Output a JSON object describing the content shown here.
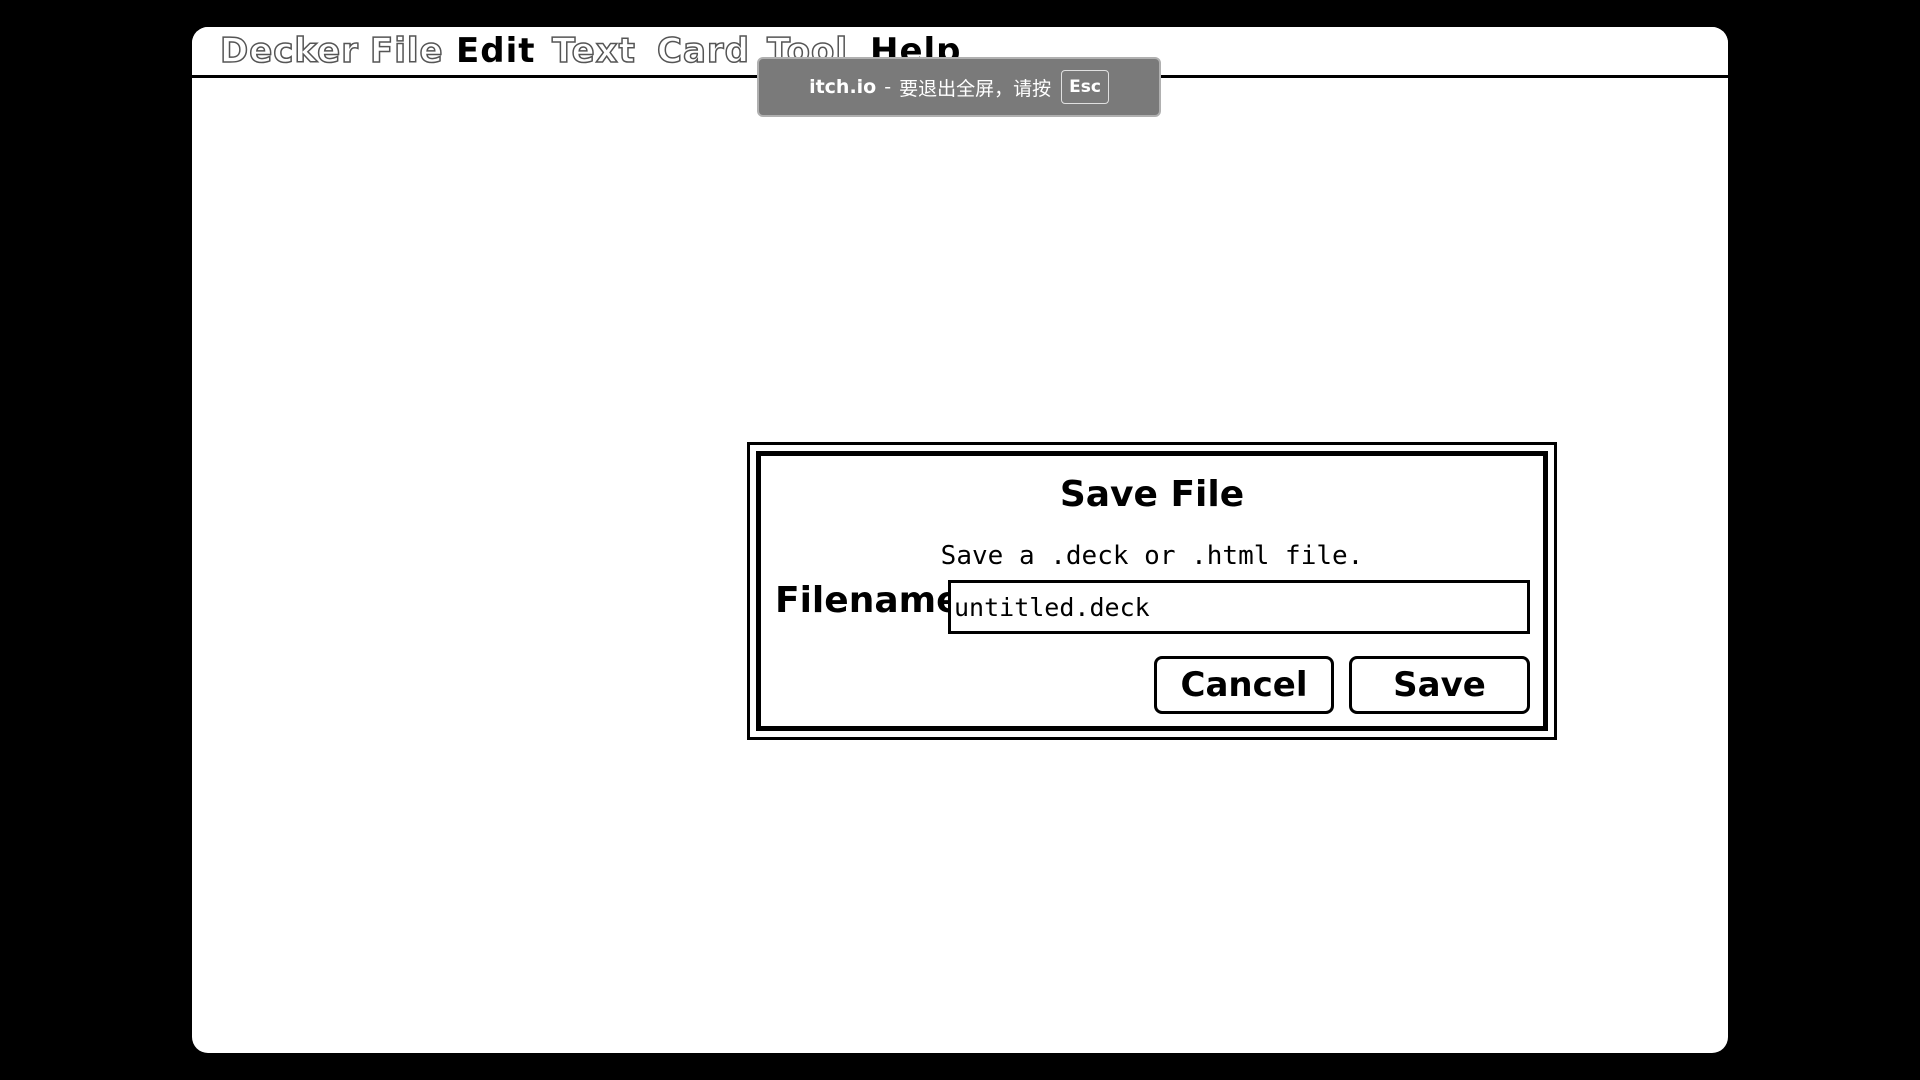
{
  "menubar": {
    "items": [
      {
        "label": "Decker",
        "enabled": false
      },
      {
        "label": "File",
        "enabled": false
      },
      {
        "label": "Edit",
        "enabled": true
      },
      {
        "label": "Text",
        "enabled": false
      },
      {
        "label": "Card",
        "enabled": false
      },
      {
        "label": "Tool",
        "enabled": false
      },
      {
        "label": "Help",
        "enabled": true
      }
    ]
  },
  "toast": {
    "site": "itch.io",
    "separator": "-",
    "message": "要退出全屏，请按",
    "key": "Esc"
  },
  "dialog": {
    "title": "Save File",
    "description": "Save a .deck or .html file.",
    "filename_label": "Filename",
    "filename_value": "untitled.deck",
    "cancel_label": "Cancel",
    "save_label": "Save"
  },
  "colors": {
    "background": "#000000",
    "screen": "#ffffff",
    "toast_bg": "#7a7a7a"
  }
}
